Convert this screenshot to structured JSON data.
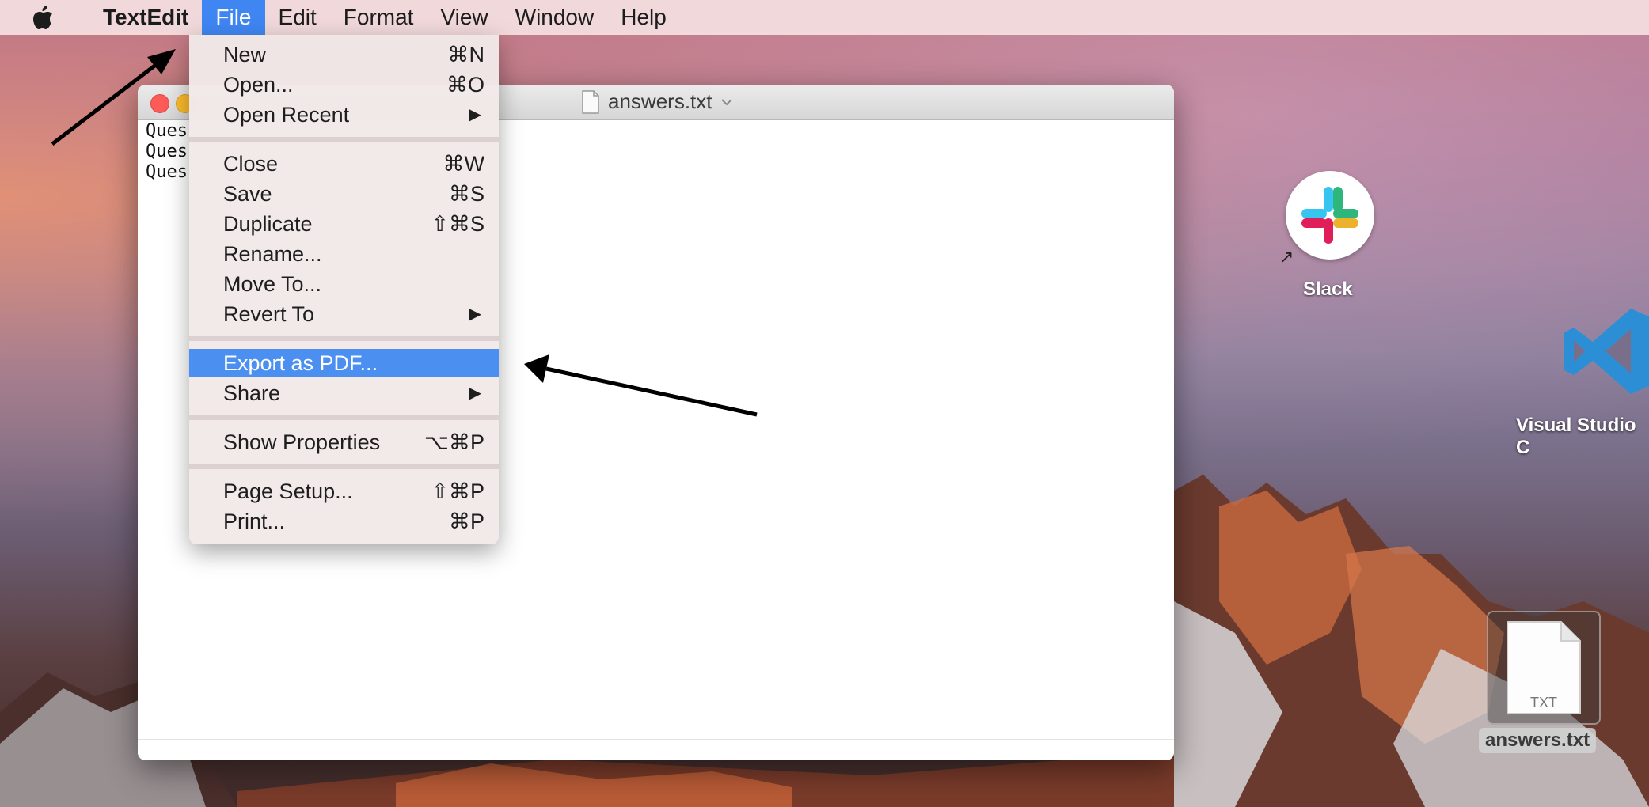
{
  "menubar": {
    "app_name": "TextEdit",
    "items": [
      "File",
      "Edit",
      "Format",
      "View",
      "Window",
      "Help"
    ]
  },
  "window": {
    "title": "answers.txt",
    "lines": [
      "Ques",
      "Ques",
      "Ques"
    ]
  },
  "file_menu": {
    "new": {
      "label": "New",
      "shortcut": "⌘N"
    },
    "open": {
      "label": "Open...",
      "shortcut": "⌘O"
    },
    "open_recent": {
      "label": "Open Recent"
    },
    "close": {
      "label": "Close",
      "shortcut": "⌘W"
    },
    "save": {
      "label": "Save",
      "shortcut": "⌘S"
    },
    "duplicate": {
      "label": "Duplicate",
      "shortcut": "⇧⌘S"
    },
    "rename": {
      "label": "Rename..."
    },
    "move_to": {
      "label": "Move To..."
    },
    "revert_to": {
      "label": "Revert To"
    },
    "export_pdf": {
      "label": "Export as PDF..."
    },
    "share": {
      "label": "Share"
    },
    "show_properties": {
      "label": "Show Properties",
      "shortcut": "⌥⌘P"
    },
    "page_setup": {
      "label": "Page Setup...",
      "shortcut": "⇧⌘P"
    },
    "print": {
      "label": "Print...",
      "shortcut": "⌘P"
    }
  },
  "desktop": {
    "slack_label": "Slack",
    "vscode_label": "Visual Studio C",
    "file_label": "answers.txt",
    "file_type": "TXT"
  },
  "colors": {
    "highlight": "#4b8ff1",
    "menubar_active": "#3f86f3"
  }
}
